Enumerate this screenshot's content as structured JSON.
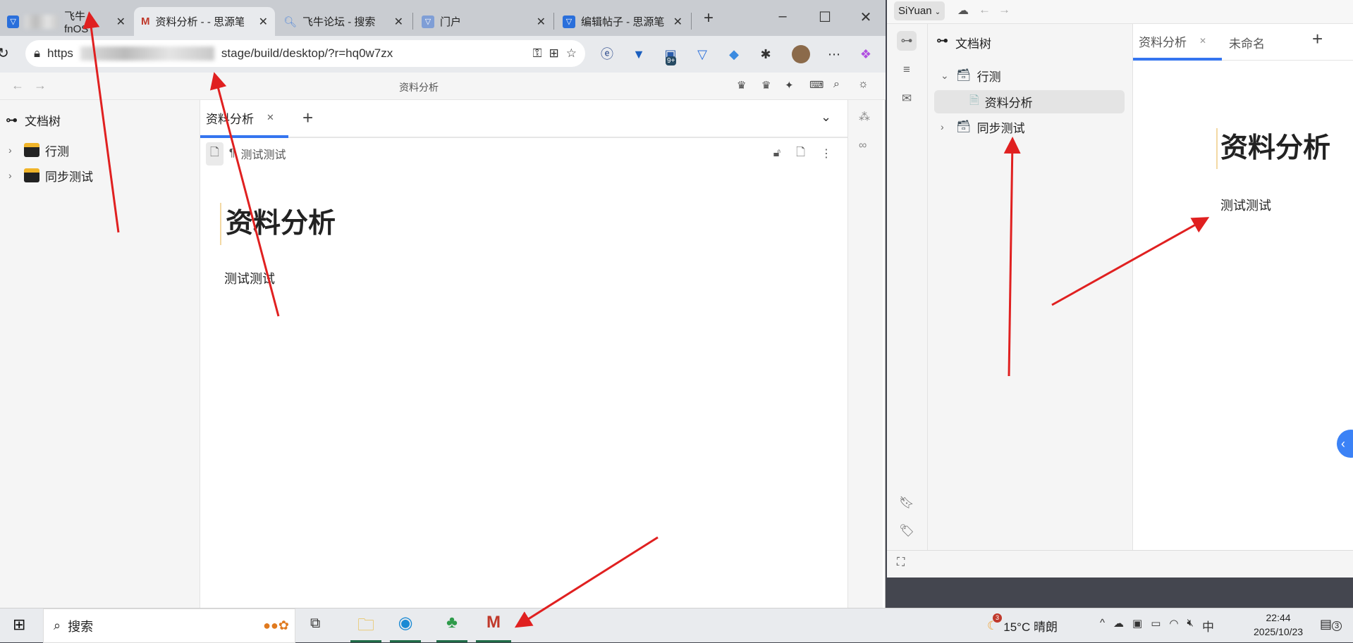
{
  "browser": {
    "tabs": [
      {
        "label": "飞牛 fnOS",
        "icon": "feiniu-icon"
      },
      {
        "label": "资料分析 - - 思源笔",
        "icon": "siyuan-icon",
        "active": true
      },
      {
        "label": "飞牛论坛 - 搜索",
        "icon": "search-icon"
      },
      {
        "label": "门户",
        "icon": "feiniu-icon"
      },
      {
        "label": "编辑帖子 - 思源笔",
        "icon": "feiniu-icon"
      }
    ],
    "new_tab": "+",
    "url_prefix": "https",
    "url_suffix": "stage/build/desktop/?r=hq0w7zx",
    "ext_badge": "9+"
  },
  "left_app": {
    "title": "资料分析",
    "tree_header": "文档树",
    "tree": [
      {
        "label": "行测"
      },
      {
        "label": "同步测试"
      }
    ],
    "tab": "资料分析",
    "breadcrumb": "测试测试",
    "doc_title": "资料分析",
    "doc_paragraph": "测试测试"
  },
  "right_app": {
    "workspace": "SiYuan",
    "tree_header": "文档树",
    "tree": [
      {
        "label": "行测",
        "expanded": true
      },
      {
        "label": "资料分析",
        "selected": true
      },
      {
        "label": "同步测试"
      }
    ],
    "tabs": [
      {
        "label": "资料分析",
        "active": true
      },
      {
        "label": "未命名"
      }
    ],
    "doc_title": "资料分析",
    "doc_paragraph": "测试测试"
  },
  "taskbar": {
    "search": "搜索",
    "weather": "15°C 晴朗",
    "weather_badge": "3",
    "ime": "中",
    "time": "22:44",
    "date": "2025/10/23",
    "notif_count": "3"
  },
  "colors": {
    "accent": "#3575f0",
    "annotation": "#e02020"
  }
}
